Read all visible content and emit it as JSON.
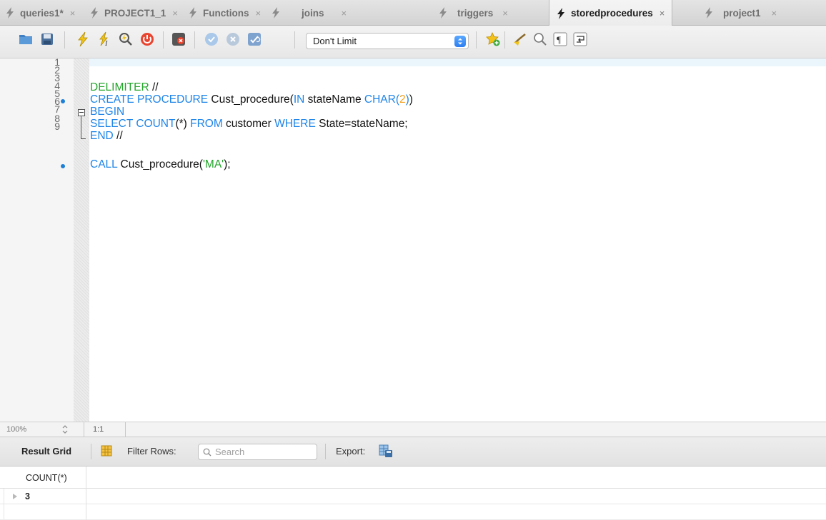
{
  "tabs": [
    {
      "label": "queries1*",
      "close": "×",
      "active": false
    },
    {
      "label": "PROJECT1_1",
      "close": "×",
      "active": false
    },
    {
      "label": "Functions",
      "close": "×",
      "active": false
    },
    {
      "label": "joins",
      "close": "×",
      "active": false
    },
    {
      "label": "triggers",
      "close": "×",
      "active": false
    },
    {
      "label": "storedprocedures",
      "close": "×",
      "active": true
    },
    {
      "label": "project1",
      "close": "×",
      "active": false
    }
  ],
  "toolbar": {
    "icons": [
      "open-folder-icon",
      "save-icon",
      "execute-icon",
      "execute-current-icon",
      "explain-icon",
      "stop-icon",
      "toggle-error-icon",
      "commit-icon",
      "rollback-icon",
      "autocommit-icon",
      "add-snippet-icon",
      "beautify-icon",
      "find-icon",
      "invisible-chars-icon",
      "wrap-lines-icon"
    ],
    "limit_value": "Don't Limit"
  },
  "editor": {
    "line_numbers": [
      "1",
      "2",
      "3",
      "4",
      "5",
      "6",
      "7",
      "8",
      "9"
    ],
    "lines": {
      "l3": {
        "kw1": "DELIMITER",
        "rest": " //"
      },
      "l4": {
        "kw1": "CREATE PROCEDURE",
        "t1": " Cust_procedure(",
        "kw2": "IN",
        "t2": " stateName ",
        "kw3": "CHAR(",
        "num": "2",
        "kw4": ")",
        "t3": ")"
      },
      "l5": {
        "kw1": "BEGIN"
      },
      "l6": {
        "kw1": "SELECT COUNT",
        "t1": "(*) ",
        "kw2": "FROM",
        "t2": " customer ",
        "kw3": "WHERE",
        "t3": " State=stateName;"
      },
      "l7": {
        "kw1": "END",
        "rest": " //"
      },
      "l9": {
        "kw1": "CALL",
        "t1": " Cust_procedure(",
        "str": "'MA'",
        "t2": ");"
      }
    },
    "breakpoint_lines": [
      4,
      9
    ]
  },
  "status": {
    "zoom": "100%",
    "cursor_position": "1:1"
  },
  "results": {
    "tab_label": "Result Grid",
    "filter_label": "Filter Rows:",
    "search_placeholder": "Search",
    "export_label": "Export:",
    "columns": [
      "COUNT(*)"
    ],
    "rows": [
      [
        "3"
      ]
    ]
  },
  "colors": {
    "keyword": "#1d84e8",
    "delimiter": "#22a52a",
    "number": "#f3a11e",
    "breakpoint": "#1e7fd6"
  }
}
